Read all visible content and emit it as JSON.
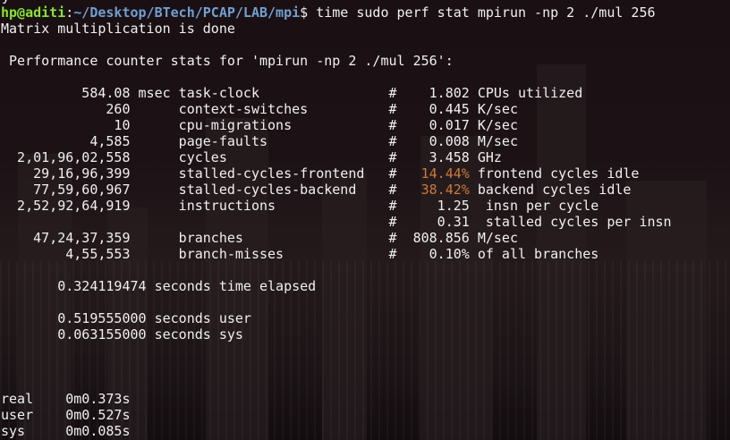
{
  "colors": {
    "user_host": "#8ae234",
    "path": "#729fcf",
    "highlight_percent": "#cc7a3b",
    "text": "#f0f0f0",
    "background": "#160e12"
  },
  "prompt": {
    "user_host": "hp@aditi",
    "separator": ":",
    "path": "~/Desktop/BTech/PCAP/LAB/mpi",
    "symbol": "$",
    "command": " time sudo perf stat mpirun -np 2 ./mul 256"
  },
  "output": {
    "program_message": "Matrix multiplication is done",
    "stats_header": " Performance counter stats for 'mpirun -np 2 ./mul 256':",
    "counters": [
      {
        "value": "          584.08",
        "unit": " msec",
        "event": " task-clock          ",
        "hash": "      #",
        "ratio": "    1.802",
        "ratio_highlight": false,
        "desc": " CPUs utilized"
      },
      {
        "value": "             260",
        "unit": "     ",
        "event": " context-switches    ",
        "hash": "      #",
        "ratio": "    0.445",
        "ratio_highlight": false,
        "desc": " K/sec"
      },
      {
        "value": "              10",
        "unit": "     ",
        "event": " cpu-migrations      ",
        "hash": "      #",
        "ratio": "    0.017",
        "ratio_highlight": false,
        "desc": " K/sec"
      },
      {
        "value": "           4,585",
        "unit": "     ",
        "event": " page-faults         ",
        "hash": "      #",
        "ratio": "    0.008",
        "ratio_highlight": false,
        "desc": " M/sec"
      },
      {
        "value": "  2,01,96,02,558",
        "unit": "     ",
        "event": " cycles              ",
        "hash": "      #",
        "ratio": "    3.458",
        "ratio_highlight": false,
        "desc": " GHz"
      },
      {
        "value": "    29,16,96,399",
        "unit": "     ",
        "event": " stalled-cycles-frontend",
        "hash": "   #",
        "ratio": "   14.44%",
        "ratio_highlight": true,
        "desc": " frontend cycles idle"
      },
      {
        "value": "    77,59,60,967",
        "unit": "     ",
        "event": " stalled-cycles-backend ",
        "hash": "   #",
        "ratio": "   38.42%",
        "ratio_highlight": true,
        "desc": " backend cycles idle"
      },
      {
        "value": "  2,52,92,64,919",
        "unit": "     ",
        "event": " instructions        ",
        "hash": "      #",
        "ratio": "     1.25",
        "ratio_highlight": false,
        "desc": "  insn per cycle"
      },
      {
        "value": "                ",
        "unit": "     ",
        "event": "                     ",
        "hash": "      #",
        "ratio": "     0.31",
        "ratio_highlight": false,
        "desc": "  stalled cycles per insn"
      },
      {
        "value": "    47,24,37,359",
        "unit": "     ",
        "event": " branches            ",
        "hash": "      #",
        "ratio": "  808.856",
        "ratio_highlight": false,
        "desc": " M/sec"
      },
      {
        "value": "        4,55,553",
        "unit": "     ",
        "event": " branch-misses       ",
        "hash": "      #",
        "ratio": "    0.10%",
        "ratio_highlight": false,
        "desc": " of all branches"
      }
    ],
    "elapsed": "       0.324119474 seconds time elapsed",
    "user_time": "       0.519555000 seconds user",
    "sys_time": "       0.063155000 seconds sys",
    "time_real": "real\t0m0.373s",
    "time_user": "user\t0m0.527s",
    "time_sys": "sys\t0m0.085s"
  }
}
